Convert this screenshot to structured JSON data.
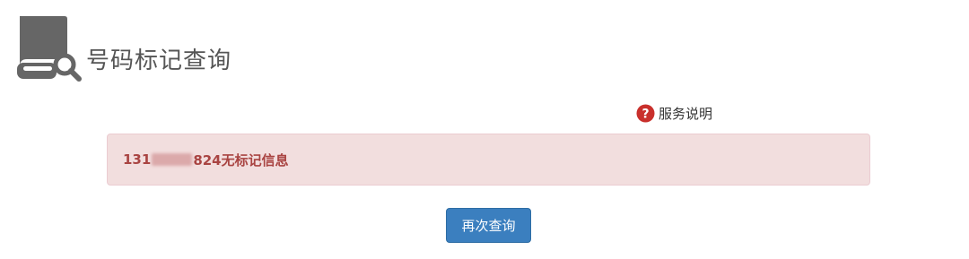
{
  "header": {
    "title": "号码标记查询",
    "icon": "book-search-icon"
  },
  "service": {
    "label": "服务说明",
    "icon": "help-question-icon"
  },
  "result": {
    "prefix": "131",
    "suffix": "824无标记信息",
    "status_color": "#a94442",
    "background_color": "#f2dede"
  },
  "actions": {
    "requery_label": "再次查询",
    "button_color": "#3b7fbf"
  }
}
